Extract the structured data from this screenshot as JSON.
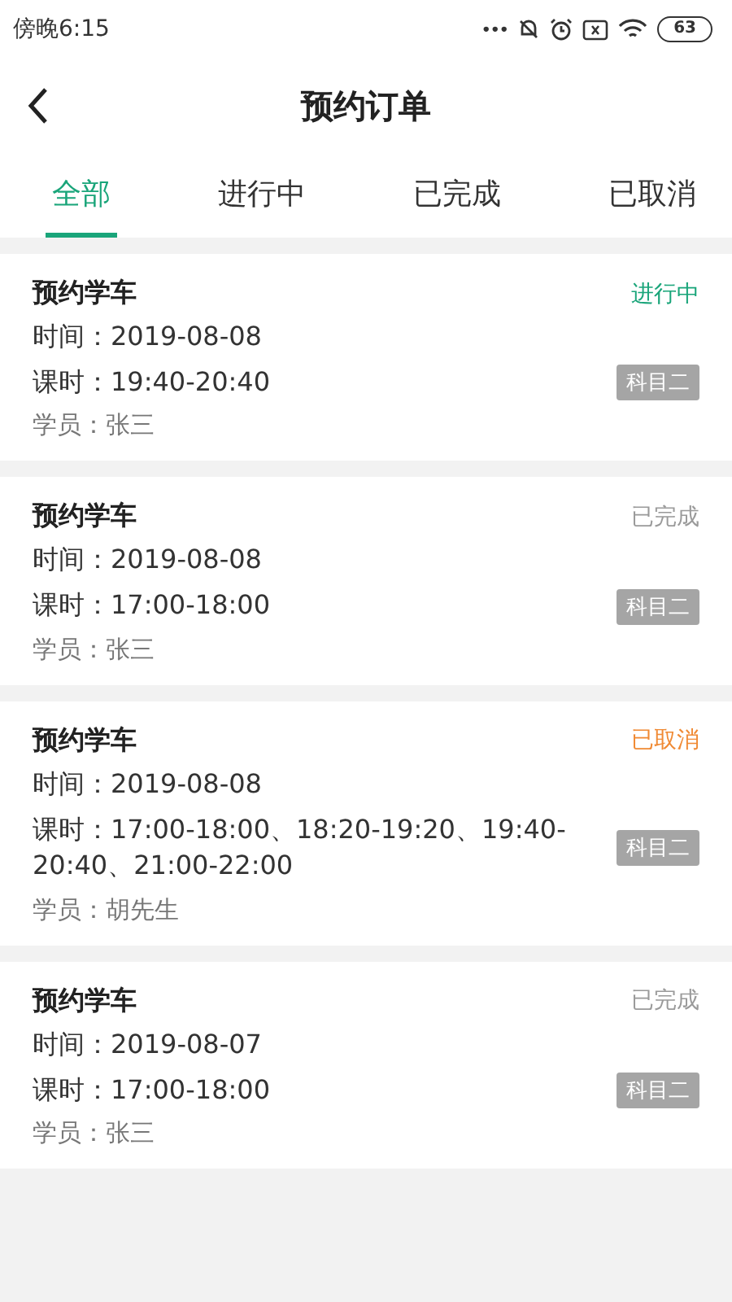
{
  "status_bar": {
    "time": "傍晚6:15",
    "dots": "•••",
    "battery": "63"
  },
  "header": {
    "title": "预约订单"
  },
  "tabs": [
    {
      "label": "全部",
      "selected": true
    },
    {
      "label": "进行中",
      "selected": false
    },
    {
      "label": "已完成",
      "selected": false
    },
    {
      "label": "已取消",
      "selected": false
    }
  ],
  "orders": [
    {
      "title": "预约学车",
      "status": "进行中",
      "color": "#1aa57a",
      "time": "时间：2019-08-08",
      "lesson": "课时：19:40-20:40",
      "tag": "科目二",
      "student": "学员：张三"
    },
    {
      "title": "预约学车",
      "status": "已完成",
      "color": "#9a9a9a",
      "time": "时间：2019-08-08",
      "lesson": "课时：17:00-18:00",
      "tag": "科目二",
      "student": "学员：张三"
    },
    {
      "title": "预约学车",
      "status": "已取消",
      "color": "#f08a34",
      "time": "时间：2019-08-08",
      "lesson": "课时：17:00-18:00、18:20-19:20、19:40-20:40、21:00-22:00",
      "tag": "科目二",
      "student": "学员：胡先生"
    },
    {
      "title": "预约学车",
      "status": "已完成",
      "color": "#9a9a9a",
      "time": "时间：2019-08-07",
      "lesson": "课时：17:00-18:00",
      "tag": "科目二",
      "student": "学员：张三"
    }
  ]
}
